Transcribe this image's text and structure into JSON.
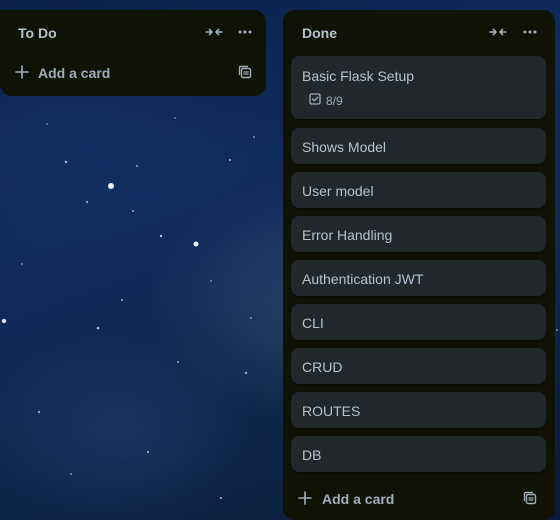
{
  "colors": {
    "list_bg": "#101204",
    "card_bg": "#22272b",
    "text": "#b6c2cf",
    "muted_text": "#9fadbc"
  },
  "lists": [
    {
      "title": "To Do",
      "collapse_icon": "collapse-arrows-icon",
      "menu_icon": "ellipsis-icon",
      "add_card_label": "Add a card",
      "template_icon": "card-template-icon",
      "cards": []
    },
    {
      "title": "Done",
      "collapse_icon": "collapse-arrows-icon",
      "menu_icon": "ellipsis-icon",
      "add_card_label": "Add a card",
      "template_icon": "card-template-icon",
      "cards": [
        {
          "title": "Basic Flask Setup",
          "checklist": "8/9",
          "checklist_icon": "checklist-icon"
        },
        {
          "title": "Shows Model"
        },
        {
          "title": "User model"
        },
        {
          "title": "Error Handling"
        },
        {
          "title": "Authentication JWT"
        },
        {
          "title": "CLI"
        },
        {
          "title": "CRUD"
        },
        {
          "title": "ROUTES"
        },
        {
          "title": "DB"
        }
      ]
    }
  ]
}
